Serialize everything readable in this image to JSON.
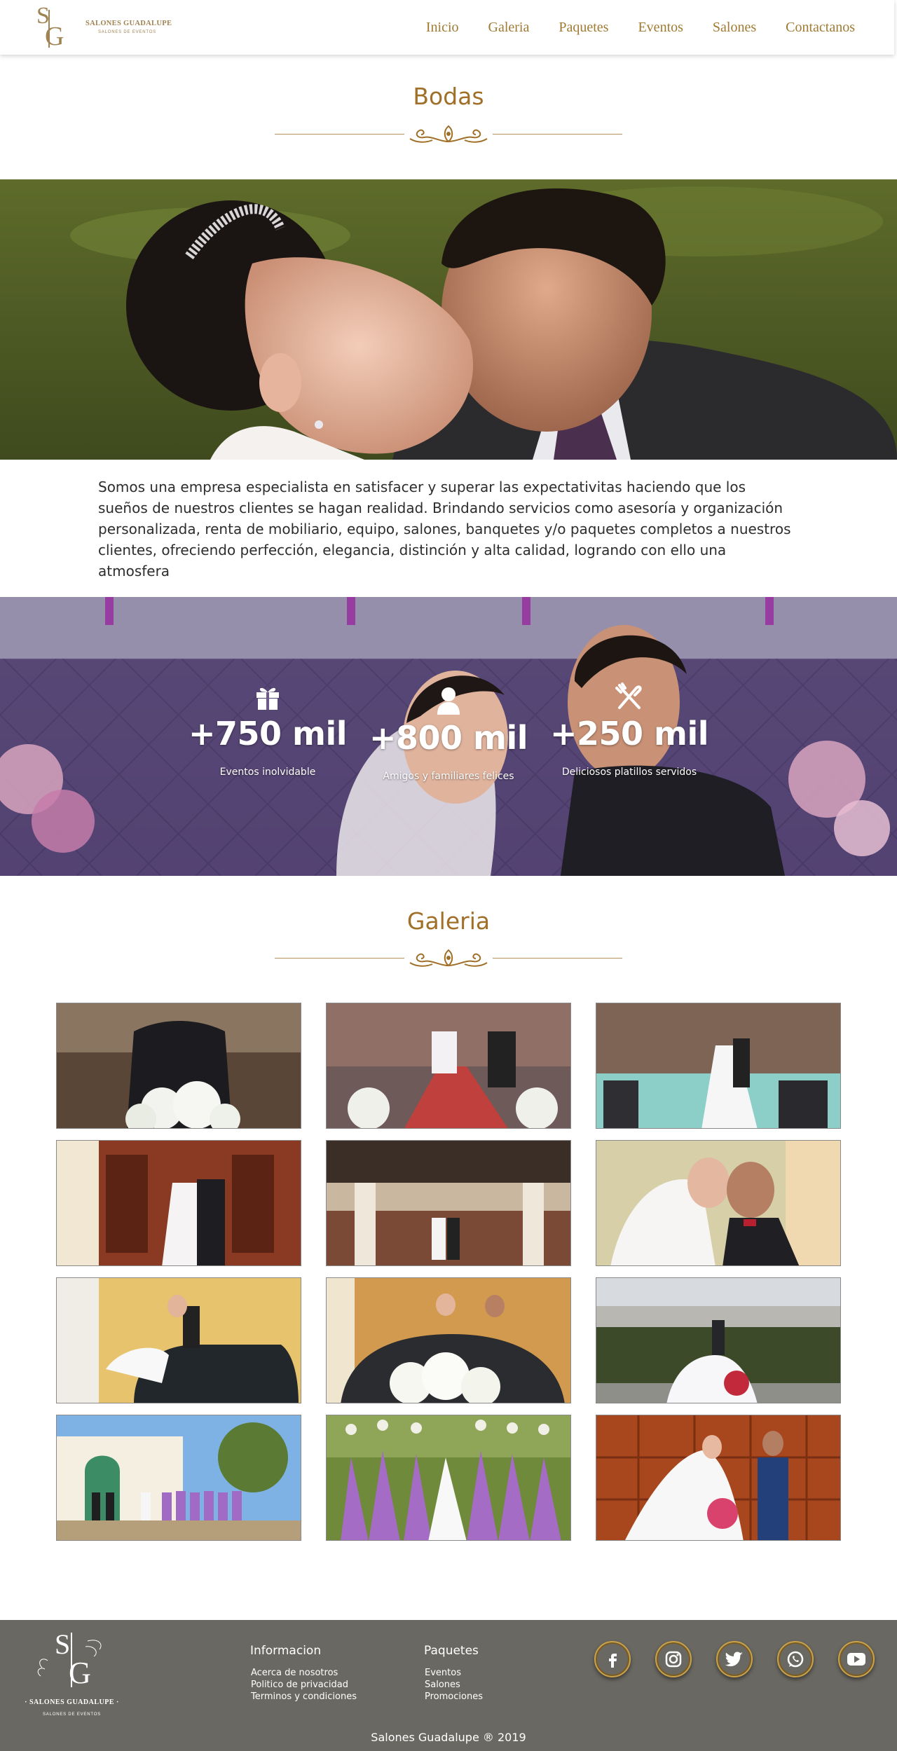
{
  "header": {
    "logo_letters": "SG",
    "logo_name": "SALONES GUADALUPE",
    "logo_tagline": "SALONES DE EVENTOS",
    "nav": [
      "Inicio",
      "Galeria",
      "Paquetes",
      "Eventos",
      "Salones",
      "Contactanos"
    ]
  },
  "bodas": {
    "title": "Bodas",
    "intro": "Somos una empresa especialista en satisfacer y superar las expectativitas haciendo que los  sueños de nuestros clientes se hagan  realidad. Brindando servicios como asesoría y organización personalizada, renta de mobiliario, equipo, salones, banquetes y/o  paquetes completos a nuestros clientes, ofreciendo perfección, elegancia, distinción y alta calidad, logrando  con ello  una  atmosfera"
  },
  "stats": [
    {
      "icon": "gift-icon",
      "value": "+750 mil",
      "label": "Eventos inolvidable"
    },
    {
      "icon": "user-icon",
      "value": "+800 mil",
      "label": "Amigos y familiares felices"
    },
    {
      "icon": "utensils-icon",
      "value": "+250 mil",
      "label": "Deliciosos platillos servidos"
    }
  ],
  "gallery": {
    "title": "Galeria",
    "count": 12
  },
  "footer": {
    "logo_name": "· SALONES GUADALUPE ·",
    "logo_tagline": "SALONES DE EVENTOS",
    "info_title": "Informacion",
    "info_links": [
      "Acerca de nosotros",
      "Politico de privacidad",
      "Terminos y condiciones"
    ],
    "packages_title": "Paquetes",
    "packages_links": [
      "Eventos",
      "Salones",
      "Promociones"
    ],
    "socials": [
      "facebook-icon",
      "instagram-icon",
      "twitter-icon",
      "whatsapp-icon",
      "youtube-icon"
    ],
    "copyright": "Salones Guadalupe ® 2019"
  },
  "colors": {
    "gold": "#a07a33",
    "footer_bg": "#6a6862",
    "social_ring": "#c9a24a"
  }
}
